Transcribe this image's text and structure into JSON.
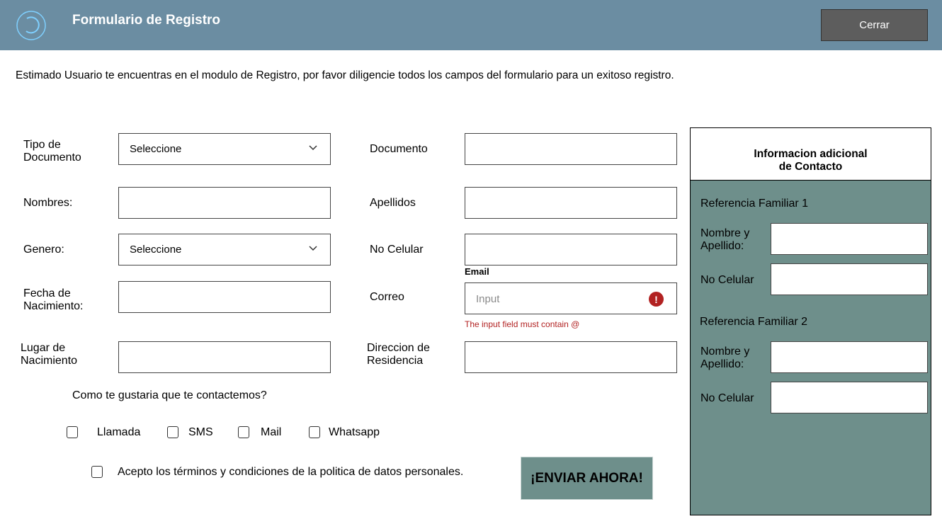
{
  "header": {
    "title": "Formulario de Registro",
    "close_label": "Cerrar",
    "bg_color": "#6b8da2"
  },
  "intro": "Estimado Usuario te encuentras en el modulo de Registro, por favor diligencie todos los campos del formulario para un exitoso registro.",
  "form": {
    "tipo_documento": {
      "label": "Tipo de\nDocumento",
      "value": "Seleccione"
    },
    "documento": {
      "label": "Documento",
      "value": ""
    },
    "nombres": {
      "label": "Nombres:",
      "value": ""
    },
    "apellidos": {
      "label": "Apellidos",
      "value": ""
    },
    "genero": {
      "label": "Genero:",
      "value": "Seleccione"
    },
    "celular": {
      "label": "No Celular",
      "value": ""
    },
    "fecha_nacimiento": {
      "label": "Fecha de\nNacimiento:",
      "value": ""
    },
    "correo": {
      "label": "Correo",
      "field_label": "Email",
      "placeholder": "Input",
      "error": "The input field must contain @",
      "error_icon": "error-icon"
    },
    "lugar_nacimiento": {
      "label": "Lugar de\nNacimiento",
      "value": ""
    },
    "direccion": {
      "label": "Direccion de\nResidencia",
      "value": ""
    }
  },
  "contact": {
    "question": "Como te gustaria que te contactemos?",
    "options": [
      {
        "label": "Llamada",
        "checked": false
      },
      {
        "label": "SMS",
        "checked": false
      },
      {
        "label": "Mail",
        "checked": false
      },
      {
        "label": "Whatsapp",
        "checked": false
      }
    ],
    "terms": {
      "label": "Acepto los términos y condiciones de la politica de datos personales.",
      "checked": false
    }
  },
  "submit_label": "¡ENVIAR AHORA!",
  "panel": {
    "title": "Informacion adicional\nde Contacto",
    "ref1": {
      "heading": "Referencia Familiar 1",
      "name_label": "Nombre y\nApellido:",
      "phone_label": "No Celular"
    },
    "ref2": {
      "heading": "Referencia Familiar 2",
      "name_label": "Nombre y\nApellido:",
      "phone_label": "No Celular"
    },
    "bg_color": "#6e8f8b"
  }
}
